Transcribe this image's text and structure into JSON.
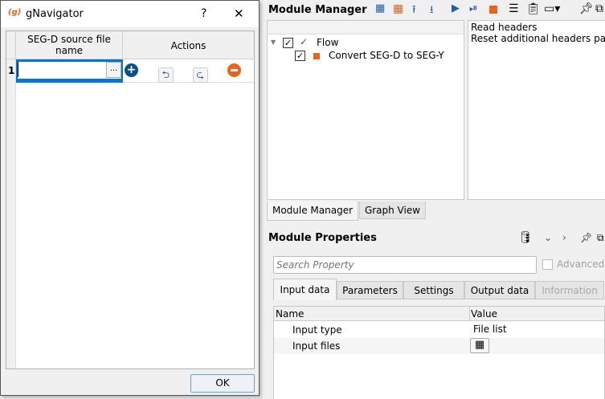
{
  "dialog": {
    "title": "gNavigator",
    "help_label": "?",
    "close_label": "✕",
    "table": {
      "columns": [
        "SEG-D source file name",
        "Actions"
      ],
      "rows": [
        {
          "index": "1",
          "value": ""
        }
      ],
      "browse_label": "..."
    },
    "ok_label": "OK"
  },
  "module_manager": {
    "title": "Module Manager",
    "tree": {
      "root": {
        "label": "Flow",
        "checked": true
      },
      "children": [
        {
          "label": "Convert SEG-D to SEG-Y",
          "checked": true,
          "color": "#e8641b"
        }
      ]
    },
    "side_list": [
      "Read headers",
      "Reset additional headers params"
    ],
    "tabs": [
      "Module Manager",
      "Graph View"
    ],
    "active_tab": "Module Manager"
  },
  "module_properties": {
    "title": "Module Properties",
    "search_placeholder": "Search Property",
    "advanced_label": "Advanced",
    "tabs": [
      "Input data",
      "Parameters",
      "Settings",
      "Output data",
      "Information"
    ],
    "active_tab": "Input data",
    "table": {
      "columns": [
        "Name",
        "Value"
      ],
      "rows": [
        {
          "name": "Input type",
          "value": "File list"
        },
        {
          "name": "Input files",
          "value": ""
        }
      ]
    }
  },
  "colors": {
    "accent": "#0078d7",
    "orange": "#e8641b",
    "blue_icon": "#1f5fa8"
  }
}
